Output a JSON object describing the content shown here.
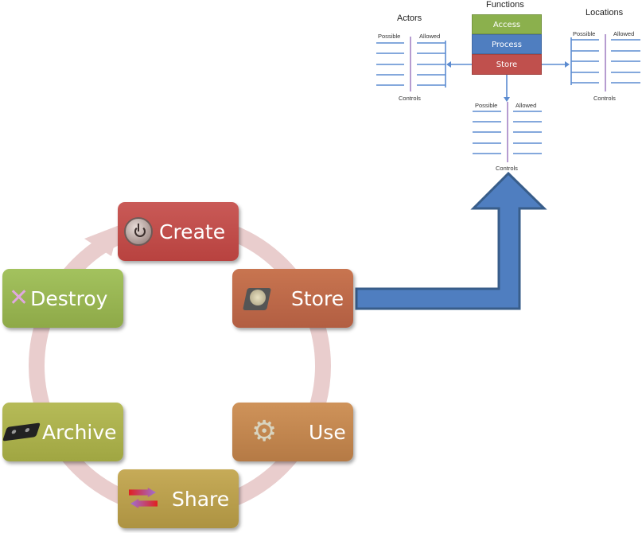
{
  "functions_diagram": {
    "title": "Functions",
    "functions": [
      {
        "label": "Access",
        "color": "#8bb04d"
      },
      {
        "label": "Process",
        "color": "#4f7ec0"
      },
      {
        "label": "Store",
        "color": "#c0504d"
      }
    ],
    "actors": {
      "title": "Actors",
      "possible": "Possible",
      "allowed": "Allowed",
      "controls": "Controls"
    },
    "locations": {
      "title": "Locations",
      "possible": "Possible",
      "allowed": "Allowed",
      "controls": "Controls"
    },
    "store_controls": {
      "possible": "Possible",
      "allowed": "Allowed",
      "controls": "Controls"
    }
  },
  "lifecycle": {
    "stages": [
      {
        "id": "create",
        "label": "Create",
        "icon": "power-button-icon",
        "color": "#c0504d"
      },
      {
        "id": "store",
        "label": "Store",
        "icon": "hard-drive-icon",
        "color": "#c0694a"
      },
      {
        "id": "use",
        "label": "Use",
        "icon": "gear-icon",
        "color": "#c08a4e"
      },
      {
        "id": "share",
        "label": "Share",
        "icon": "exchange-arrows-icon",
        "color": "#b8a24a"
      },
      {
        "id": "archive",
        "label": "Archive",
        "icon": "tape-cartridge-icon",
        "color": "#a9b24c"
      },
      {
        "id": "destroy",
        "label": "Destroy",
        "icon": "x-mark-icon",
        "color": "#98b452"
      }
    ],
    "cycle_color": "#e8c4c4",
    "connector_color": "#4f7ec0"
  }
}
